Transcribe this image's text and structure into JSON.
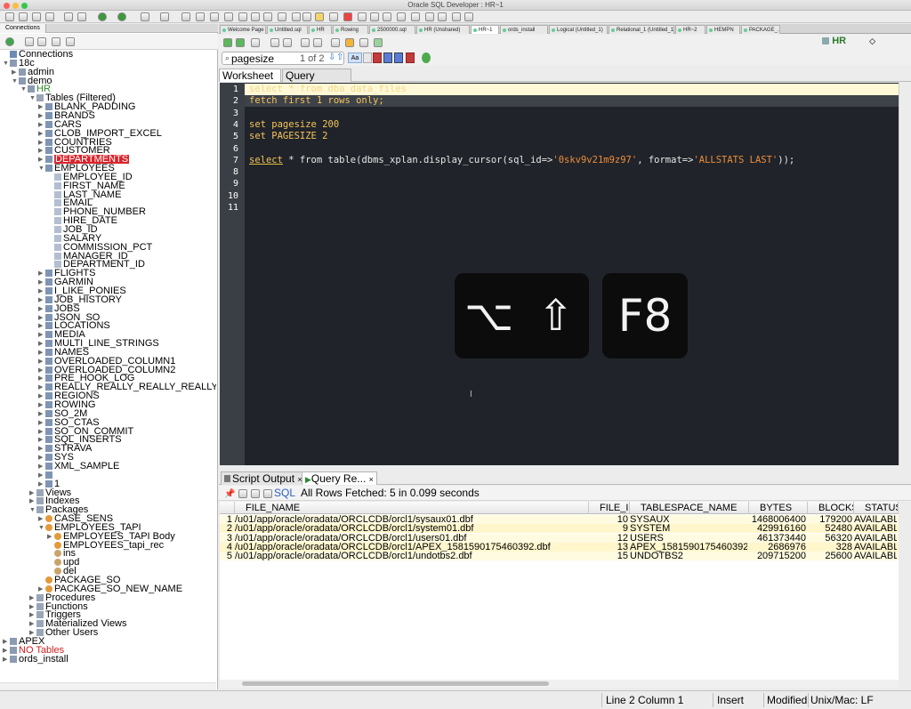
{
  "window": {
    "title": "Oracle SQL Developer : HR~1",
    "traffic_lights": [
      "#fc605b",
      "#fdbc40",
      "#34c84a"
    ]
  },
  "connections_panel": {
    "tab_label": "Connections",
    "tree": [
      {
        "label": "Connections",
        "depth": 0,
        "toggle": "",
        "icon": "connections-root-icon"
      },
      {
        "label": "18c",
        "depth": 0,
        "toggle": "open",
        "icon": "database-icon"
      },
      {
        "label": "admin",
        "depth": 1,
        "toggle": "closed",
        "icon": "connection-icon"
      },
      {
        "label": "demo",
        "depth": 1,
        "toggle": "open",
        "icon": "connection-icon"
      },
      {
        "label": "HR",
        "depth": 2,
        "toggle": "open",
        "icon": "connection-icon",
        "color": "#2e8b2e"
      },
      {
        "label": "Tables (Filtered)",
        "depth": 3,
        "toggle": "open",
        "icon": "folder-icon"
      },
      {
        "label": "BLANK_PADDING",
        "depth": 4,
        "toggle": "closed",
        "icon": "table-icon"
      },
      {
        "label": "BRANDS",
        "depth": 4,
        "toggle": "closed",
        "icon": "table-icon"
      },
      {
        "label": "CARS",
        "depth": 4,
        "toggle": "closed",
        "icon": "table-icon"
      },
      {
        "label": "CLOB_IMPORT_EXCEL",
        "depth": 4,
        "toggle": "closed",
        "icon": "table-icon"
      },
      {
        "label": "COUNTRIES",
        "depth": 4,
        "toggle": "closed",
        "icon": "table-icon"
      },
      {
        "label": "CUSTOMER",
        "depth": 4,
        "toggle": "closed",
        "icon": "table-icon"
      },
      {
        "label": "DEPARTMENTS",
        "depth": 4,
        "toggle": "closed",
        "icon": "table-icon",
        "selected": true
      },
      {
        "label": "EMPLOYEES",
        "depth": 4,
        "toggle": "open",
        "icon": "table-icon"
      },
      {
        "label": "EMPLOYEE_ID",
        "depth": 5,
        "toggle": "",
        "icon": "column-icon"
      },
      {
        "label": "FIRST_NAME",
        "depth": 5,
        "toggle": "",
        "icon": "column-icon"
      },
      {
        "label": "LAST_NAME",
        "depth": 5,
        "toggle": "",
        "icon": "column-icon"
      },
      {
        "label": "EMAIL",
        "depth": 5,
        "toggle": "",
        "icon": "column-icon"
      },
      {
        "label": "PHONE_NUMBER",
        "depth": 5,
        "toggle": "",
        "icon": "column-icon"
      },
      {
        "label": "HIRE_DATE",
        "depth": 5,
        "toggle": "",
        "icon": "column-icon"
      },
      {
        "label": "JOB_ID",
        "depth": 5,
        "toggle": "",
        "icon": "column-icon"
      },
      {
        "label": "SALARY",
        "depth": 5,
        "toggle": "",
        "icon": "column-icon"
      },
      {
        "label": "COMMISSION_PCT",
        "depth": 5,
        "toggle": "",
        "icon": "column-icon"
      },
      {
        "label": "MANAGER_ID",
        "depth": 5,
        "toggle": "",
        "icon": "column-icon"
      },
      {
        "label": "DEPARTMENT_ID",
        "depth": 5,
        "toggle": "",
        "icon": "column-icon"
      },
      {
        "label": "FLIGHTS",
        "depth": 4,
        "toggle": "closed",
        "icon": "table-icon"
      },
      {
        "label": "GARMIN",
        "depth": 4,
        "toggle": "closed",
        "icon": "table-icon"
      },
      {
        "label": "I_LIKE_PONIES",
        "depth": 4,
        "toggle": "closed",
        "icon": "table-icon"
      },
      {
        "label": "JOB_HISTORY",
        "depth": 4,
        "toggle": "closed",
        "icon": "table-icon"
      },
      {
        "label": "JOBS",
        "depth": 4,
        "toggle": "closed",
        "icon": "table-icon"
      },
      {
        "label": "JSON_SO",
        "depth": 4,
        "toggle": "closed",
        "icon": "table-icon"
      },
      {
        "label": "LOCATIONS",
        "depth": 4,
        "toggle": "closed",
        "icon": "table-icon"
      },
      {
        "label": "MEDIA",
        "depth": 4,
        "toggle": "closed",
        "icon": "table-icon"
      },
      {
        "label": "MULTI_LINE_STRINGS",
        "depth": 4,
        "toggle": "closed",
        "icon": "table-icon"
      },
      {
        "label": "NAMES",
        "depth": 4,
        "toggle": "closed",
        "icon": "table-icon"
      },
      {
        "label": "OVERLOADED_COLUMN1",
        "depth": 4,
        "toggle": "closed",
        "icon": "table-icon"
      },
      {
        "label": "OVERLOADED_COLUMN2",
        "depth": 4,
        "toggle": "closed",
        "icon": "table-icon"
      },
      {
        "label": "PRE_HOOK_LOG",
        "depth": 4,
        "toggle": "closed",
        "icon": "table-icon"
      },
      {
        "label": "REALLY_REALLY_REALLY_REALLY_R",
        "depth": 4,
        "toggle": "closed",
        "icon": "table-icon"
      },
      {
        "label": "REGIONS",
        "depth": 4,
        "toggle": "closed",
        "icon": "table-icon"
      },
      {
        "label": "ROWING",
        "depth": 4,
        "toggle": "closed",
        "icon": "table-icon"
      },
      {
        "label": "SO_2M",
        "depth": 4,
        "toggle": "closed",
        "icon": "table-icon"
      },
      {
        "label": "SO_CTAS",
        "depth": 4,
        "toggle": "closed",
        "icon": "table-icon"
      },
      {
        "label": "SO_ON_COMMIT",
        "depth": 4,
        "toggle": "closed",
        "icon": "table-icon"
      },
      {
        "label": "SQL_INSERTS",
        "depth": 4,
        "toggle": "closed",
        "icon": "table-icon"
      },
      {
        "label": "STRAVA",
        "depth": 4,
        "toggle": "closed",
        "icon": "table-icon"
      },
      {
        "label": "SYS",
        "depth": 4,
        "toggle": "closed",
        "icon": "table-icon"
      },
      {
        "label": "XML_SAMPLE",
        "depth": 4,
        "toggle": "closed",
        "icon": "table-icon"
      },
      {
        "label": "",
        "depth": 4,
        "toggle": "closed",
        "icon": "table-icon"
      },
      {
        "label": "1",
        "depth": 4,
        "toggle": "closed",
        "icon": "table-icon"
      },
      {
        "label": "Views",
        "depth": 3,
        "toggle": "closed",
        "icon": "folder-icon"
      },
      {
        "label": "Indexes",
        "depth": 3,
        "toggle": "closed",
        "icon": "folder-icon"
      },
      {
        "label": "Packages",
        "depth": 3,
        "toggle": "open",
        "icon": "folder-icon"
      },
      {
        "label": "CASE_SENS",
        "depth": 4,
        "toggle": "closed",
        "icon": "package-icon"
      },
      {
        "label": "EMPLOYEES_TAPI",
        "depth": 4,
        "toggle": "open",
        "icon": "package-icon"
      },
      {
        "label": "EMPLOYEES_TAPI Body",
        "depth": 5,
        "toggle": "closed",
        "icon": "package-icon"
      },
      {
        "label": "EMPLOYEES_tapi_rec",
        "depth": 5,
        "toggle": "",
        "icon": "package-icon"
      },
      {
        "label": "ins",
        "depth": 5,
        "toggle": "",
        "icon": "procedure-icon"
      },
      {
        "label": "upd",
        "depth": 5,
        "toggle": "",
        "icon": "procedure-icon"
      },
      {
        "label": "del",
        "depth": 5,
        "toggle": "",
        "icon": "procedure-icon"
      },
      {
        "label": "PACKAGE_SO",
        "depth": 4,
        "toggle": "",
        "icon": "package-icon"
      },
      {
        "label": "PACKAGE_SO_NEW_NAME",
        "depth": 4,
        "toggle": "closed",
        "icon": "package-icon"
      },
      {
        "label": "Procedures",
        "depth": 3,
        "toggle": "closed",
        "icon": "folder-icon"
      },
      {
        "label": "Functions",
        "depth": 3,
        "toggle": "closed",
        "icon": "folder-icon"
      },
      {
        "label": "Triggers",
        "depth": 3,
        "toggle": "closed",
        "icon": "folder-icon"
      },
      {
        "label": "Materialized Views",
        "depth": 3,
        "toggle": "closed",
        "icon": "folder-icon"
      },
      {
        "label": "Other Users",
        "depth": 3,
        "toggle": "closed",
        "icon": "folder-icon"
      },
      {
        "label": "APEX",
        "depth": 0,
        "toggle": "closed",
        "icon": "database-icon"
      },
      {
        "label": "NO Tables",
        "depth": 0,
        "toggle": "closed",
        "icon": "database-icon",
        "color": "#d01e1e"
      },
      {
        "label": "ords_install",
        "depth": 0,
        "toggle": "closed",
        "icon": "database-icon"
      }
    ]
  },
  "doc_tabs": [
    {
      "label": "Welcome Page",
      "active": false
    },
    {
      "label": "Untitled.sql",
      "active": false
    },
    {
      "label": "HR",
      "active": false
    },
    {
      "label": "Rowing",
      "active": false
    },
    {
      "label": "2500000.sql",
      "active": false
    },
    {
      "label": "HR (Unshared)",
      "active": false
    },
    {
      "label": "HR~1",
      "active": true
    },
    {
      "label": "ords_install",
      "active": false
    },
    {
      "label": "Logical (Untitled_1)",
      "active": false
    },
    {
      "label": "Relational_1 (Untitled_1)",
      "active": false
    },
    {
      "label": "HR~2",
      "active": false
    },
    {
      "label": "HEMPN",
      "active": false
    },
    {
      "label": "PACKAGE_...",
      "active": false
    }
  ],
  "editor": {
    "connection_label": "HR",
    "find": {
      "value": "pagesize",
      "match_count": "1 of 2"
    },
    "subtabs": [
      "Worksheet",
      "Query Builder"
    ],
    "active_subtab": 0,
    "lines": [
      {
        "n": "1",
        "segs": [
          {
            "t": "select * from ",
            "c": "kw"
          },
          {
            "t": "dba_data_files",
            "c": "plain"
          }
        ]
      },
      {
        "n": "2",
        "segs": [
          {
            "t": "fetch first 1 rows only;",
            "c": "kw"
          }
        ]
      },
      {
        "n": "3",
        "segs": []
      },
      {
        "n": "4",
        "segs": [
          {
            "t": "set pagesize ",
            "c": "kw"
          },
          {
            "t": "200",
            "c": "num"
          }
        ]
      },
      {
        "n": "5",
        "segs": [
          {
            "t": "set PAGESIZE 2",
            "c": "kw"
          }
        ]
      },
      {
        "n": "6",
        "segs": []
      },
      {
        "n": "7",
        "segs": [
          {
            "t": "select",
            "c": "kw"
          },
          {
            "t": " * from table(dbms_xplan.display_cursor(sql_id=>",
            "c": "plain"
          },
          {
            "t": "'0skv9v21m9z97'",
            "c": "str"
          },
          {
            "t": ", format=>",
            "c": "plain"
          },
          {
            "t": "'ALLSTATS LAST'",
            "c": "str"
          },
          {
            "t": "));",
            "c": "plain"
          }
        ]
      },
      {
        "n": "8",
        "segs": []
      },
      {
        "n": "9",
        "segs": []
      },
      {
        "n": "10",
        "segs": []
      },
      {
        "n": "11",
        "segs": []
      }
    ],
    "keystroke_overlay": {
      "modifiers": "⌥ ⇧",
      "key": "F8"
    }
  },
  "results": {
    "tabs": [
      {
        "label": "Script Output",
        "close": "×"
      },
      {
        "label": "Query Re...",
        "close": "×"
      }
    ],
    "active_tab": 1,
    "sql_label": "SQL",
    "status": "All Rows Fetched: 5 in 0.099 seconds",
    "columns": [
      "FILE_NAME",
      "FILE_ID",
      "TABLESPACE_NAME",
      "BYTES",
      "BLOCKS",
      "STATUS"
    ],
    "rows": [
      [
        "1",
        "/u01/app/oracle/oradata/ORCLCDB/orcl1/sysaux01.dbf",
        "10",
        "SYSAUX",
        "1468006400",
        "179200",
        "AVAILABL"
      ],
      [
        "2",
        "/u01/app/oracle/oradata/ORCLCDB/orcl1/system01.dbf",
        "9",
        "SYSTEM",
        "429916160",
        "52480",
        "AVAILABL"
      ],
      [
        "3",
        "/u01/app/oracle/oradata/ORCLCDB/orcl1/users01.dbf",
        "12",
        "USERS",
        "461373440",
        "56320",
        "AVAILABL"
      ],
      [
        "4",
        "/u01/app/oracle/oradata/ORCLCDB/orcl1/APEX_1581590175460392.dbf",
        "13",
        "APEX_1581590175460392",
        "2686976",
        "328",
        "AVAILABL"
      ],
      [
        "5",
        "/u01/app/oracle/oradata/ORCLCDB/orcl1/undotbs2.dbf",
        "15",
        "UNDOTBS2",
        "209715200",
        "25600",
        "AVAILABL"
      ]
    ]
  },
  "status_bar": {
    "position": "Line 2 Column 1",
    "mode": "Insert",
    "modified": "Modified",
    "line_endings": "Unix/Mac: LF"
  }
}
